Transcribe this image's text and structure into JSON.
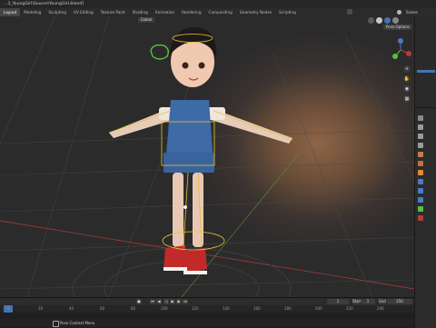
{
  "window": {
    "title": "...3_YoungGirl\\Source\\YoungGirl.blend]"
  },
  "topbar": {
    "tabs": [
      "Layout",
      "Modeling",
      "Sculpting",
      "UV Editing",
      "Texture Paint",
      "Shading",
      "Animation",
      "Rendering",
      "Compositing",
      "Geometry Nodes",
      "Scripting"
    ],
    "active_tab": "Layout",
    "scene_label": "Scene"
  },
  "viewport": {
    "mode": "Global",
    "pose_options": "Pose Options",
    "nav_gizmo": {
      "x": "X",
      "y": "Y",
      "z": "Z"
    }
  },
  "timeline": {
    "start_label": "Start",
    "start_value": "1",
    "end_label": "End",
    "end_value": "250",
    "current_frame": "1",
    "ruler": [
      "0",
      "20",
      "40",
      "60",
      "80",
      "100",
      "120",
      "140",
      "160",
      "180",
      "200",
      "220",
      "240"
    ]
  },
  "status": {
    "text": "Pose Context Menu"
  },
  "colors": {
    "accent": "#4772b3",
    "bg": "#1d1d1d",
    "bone_yellow": "#e3c23a",
    "bone_green": "#5bbf3b",
    "axis_red": "#b43c3c"
  }
}
